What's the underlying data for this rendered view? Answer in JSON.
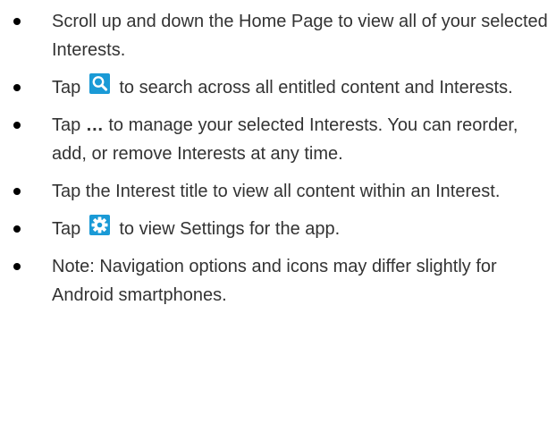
{
  "icons": {
    "search_icon": "search-icon",
    "settings_icon": "gear-icon",
    "icon_bg": "#1a9ad6",
    "icon_fg": "#ffffff"
  },
  "bullets": [
    {
      "text": "Scroll up and down the Home Page to view all of your selected Interests."
    },
    {
      "before": "Tap",
      "after": " to search across all entitled content and Interests."
    },
    {
      "before": "Tap ",
      "bold": "…",
      "after": " to manage your selected Interests. You can reorder, add, or remove Interests at any time."
    },
    {
      "text": "Tap the Interest title to view all content within an Interest."
    },
    {
      "before": "Tap",
      "after": " to view Settings for the app."
    },
    {
      "text": "Note: Navigation options and icons may differ slightly for Android smartphones."
    }
  ]
}
